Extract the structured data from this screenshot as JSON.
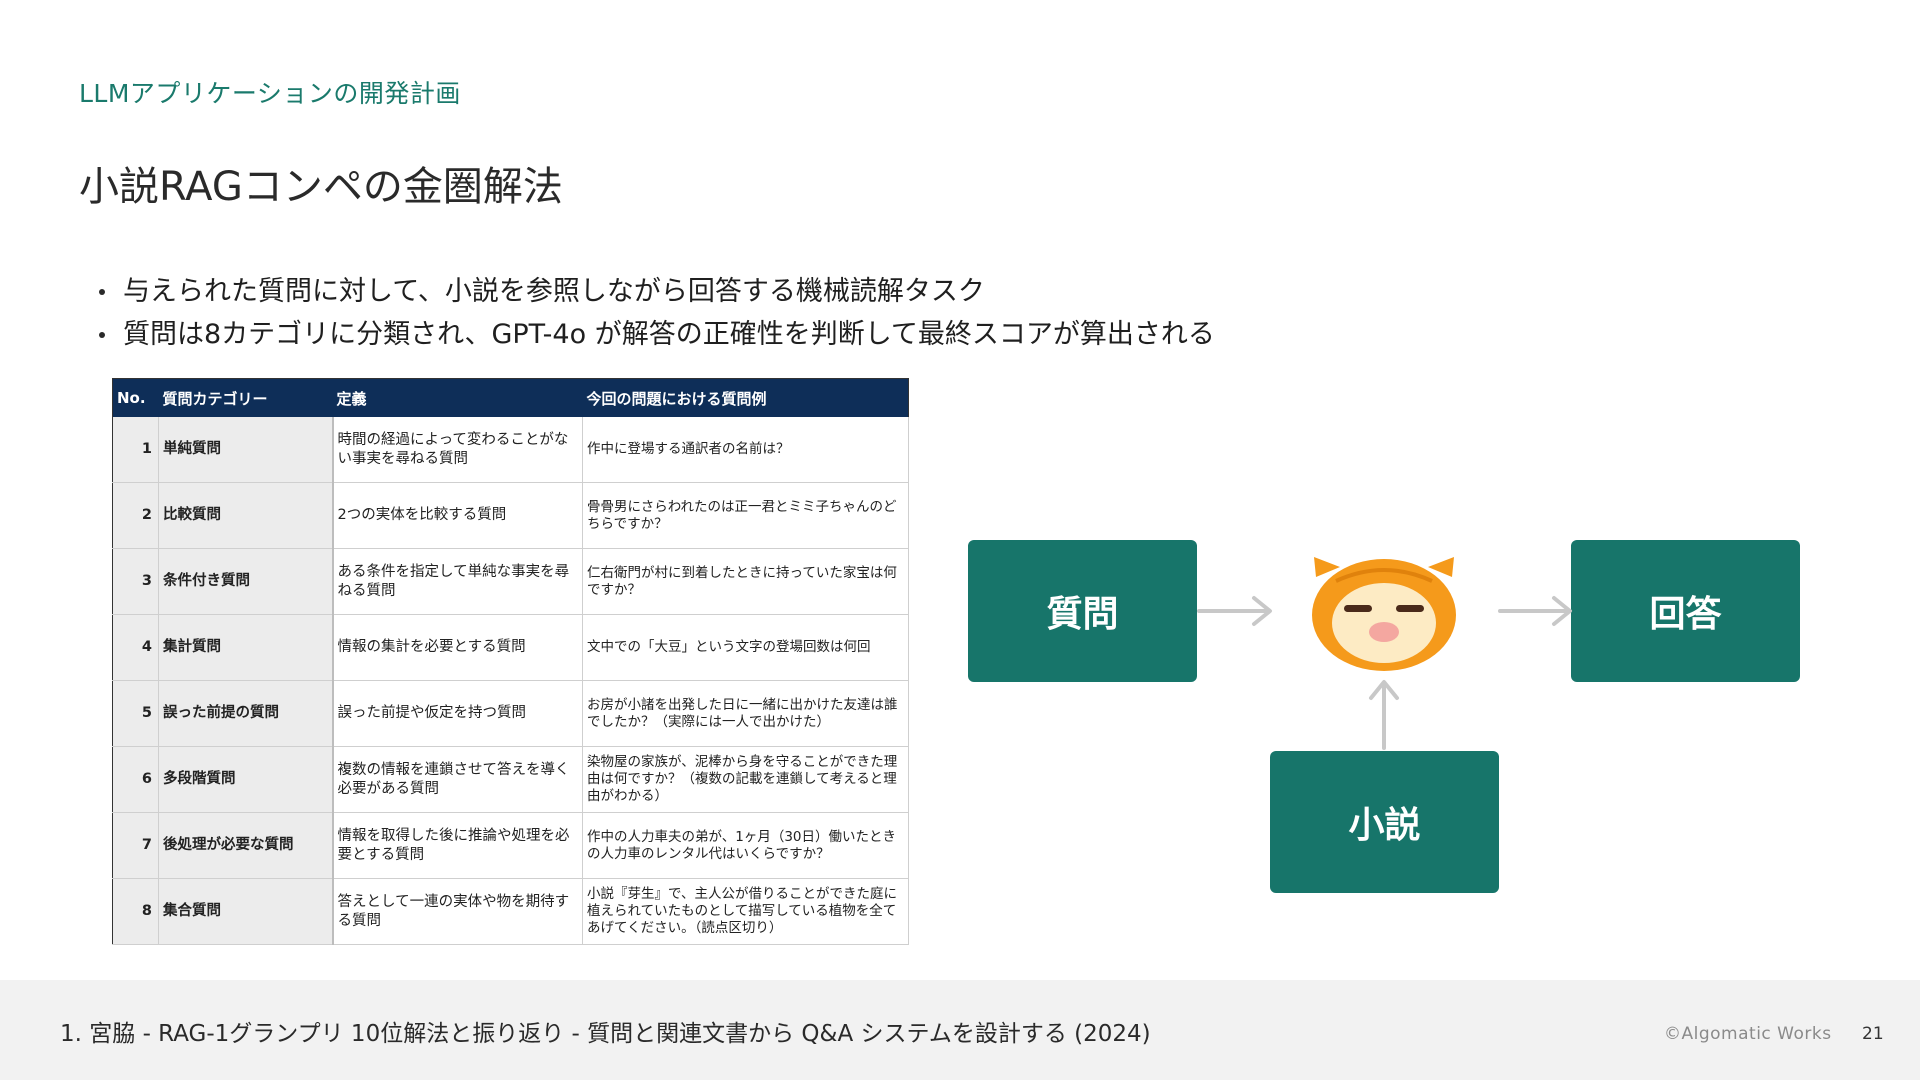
{
  "header": {
    "section": "LLMアプリケーションの開発計画",
    "title": "小説RAGコンペの金圏解法"
  },
  "bullets": [
    "与えられた質問に対して、小説を参照しながら回答する機械読解タスク",
    "質問は8カテゴリに分類され、GPT-4o が解答の正確性を判断して最終スコアが算出される"
  ],
  "table": {
    "headers": [
      "No.",
      "質問カテゴリー",
      "定義",
      "今回の問題における質問例"
    ],
    "rows": [
      {
        "no": "1",
        "category": "単純質問",
        "definition": "時間の経過によって変わることがない事実を尋ねる質問",
        "example": "作中に登場する通訳者の名前は？"
      },
      {
        "no": "2",
        "category": "比較質問",
        "definition": "2つの実体を比較する質問",
        "example": "骨骨男にさらわれたのは正一君とミミ子ちゃんのどちらですか？"
      },
      {
        "no": "3",
        "category": "条件付き質問",
        "definition": "ある条件を指定して単純な事実を尋ねる質問",
        "example": "仁右衛門が村に到着したときに持っていた家宝は何ですか？"
      },
      {
        "no": "4",
        "category": "集計質問",
        "definition": "情報の集計を必要とする質問",
        "example": "文中での「大豆」という文字の登場回数は何回"
      },
      {
        "no": "5",
        "category": "誤った前提の質問",
        "definition": "誤った前提や仮定を持つ質問",
        "example": "お房が小諸を出発した日に一緒に出かけた友達は誰でしたか？（実際には一人で出かけた）"
      },
      {
        "no": "6",
        "category": "多段階質問",
        "definition": "複数の情報を連鎖させて答えを導く必要がある質問",
        "example": "染物屋の家族が、泥棒から身を守ることができた理由は何ですか？（複数の記載を連鎖して考えると理由がわかる）"
      },
      {
        "no": "7",
        "category": "後処理が必要な質問",
        "definition": "情報を取得した後に推論や処理を必要とする質問",
        "example": "作中の人力車夫の弟が、1ヶ月（30日）働いたときの人力車のレンタル代はいくらですか？"
      },
      {
        "no": "8",
        "category": "集合質問",
        "definition": "答えとして一連の実体や物を期待する質問",
        "example": "小説『芽生』で、主人公が借りることができた庭に植えられていたものとして描写している植物を全てあげてください。（読点区切り）"
      }
    ]
  },
  "diagram": {
    "question": "質問",
    "answer": "回答",
    "novel": "小説",
    "colors": {
      "box": "#17756a",
      "arrow": "#c8c8c8",
      "mascot": "#f59a1b"
    }
  },
  "footer": {
    "footnote": "1. 宮脇 - RAG-1グランプリ 10位解法と振り返り - 質問と関連文書から Q&A システムを設計する (2024)",
    "copyright": "©Algomatic Works",
    "page": "21"
  }
}
